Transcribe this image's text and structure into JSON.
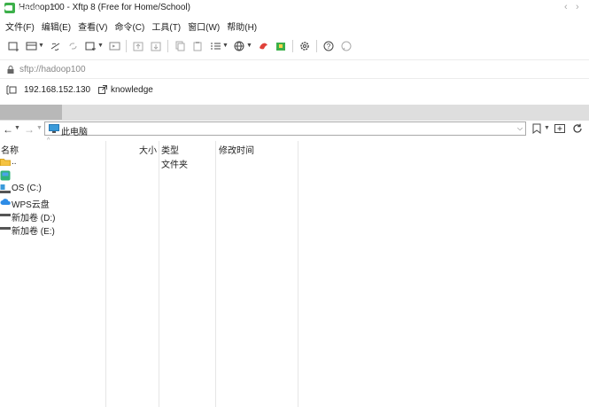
{
  "window": {
    "title": "Hadoop100 - Xftp 8 (Free for Home/School)"
  },
  "menu": [
    "文件(F)",
    "编辑(E)",
    "查看(V)",
    "命令(C)",
    "工具(T)",
    "窗口(W)",
    "帮助(H)"
  ],
  "address": {
    "value": "sftp://hadoop100"
  },
  "session": {
    "host": "192.168.152.130",
    "name": "knowledge"
  },
  "tabs": {
    "local_label": "此电脑",
    "close": "×",
    "prev": "‹",
    "next": "›"
  },
  "nav": {
    "path": "此电脑"
  },
  "columns": {
    "name": "名称",
    "size": "大小",
    "type": "类型",
    "modified": "修改时间"
  },
  "rows": [
    {
      "name": "..",
      "type": "文件夹",
      "icon": "folder-icon"
    },
    {
      "name": "",
      "type": "",
      "icon": "app-shortcut-icon"
    },
    {
      "name": "OS (C:)",
      "type": "",
      "icon": "system-drive-icon"
    },
    {
      "name": "WPS云盘",
      "type": "",
      "icon": "cloud-drive-icon"
    },
    {
      "name": "新加卷 (D:)",
      "type": "",
      "icon": "drive-icon"
    },
    {
      "name": "新加卷 (E:)",
      "type": "",
      "icon": "drive-icon"
    }
  ],
  "colors": {
    "accent": "#1a73c8",
    "tab_active": "#b8b8b8",
    "folder": "#f5c342",
    "app_green": "#3cb04a"
  }
}
